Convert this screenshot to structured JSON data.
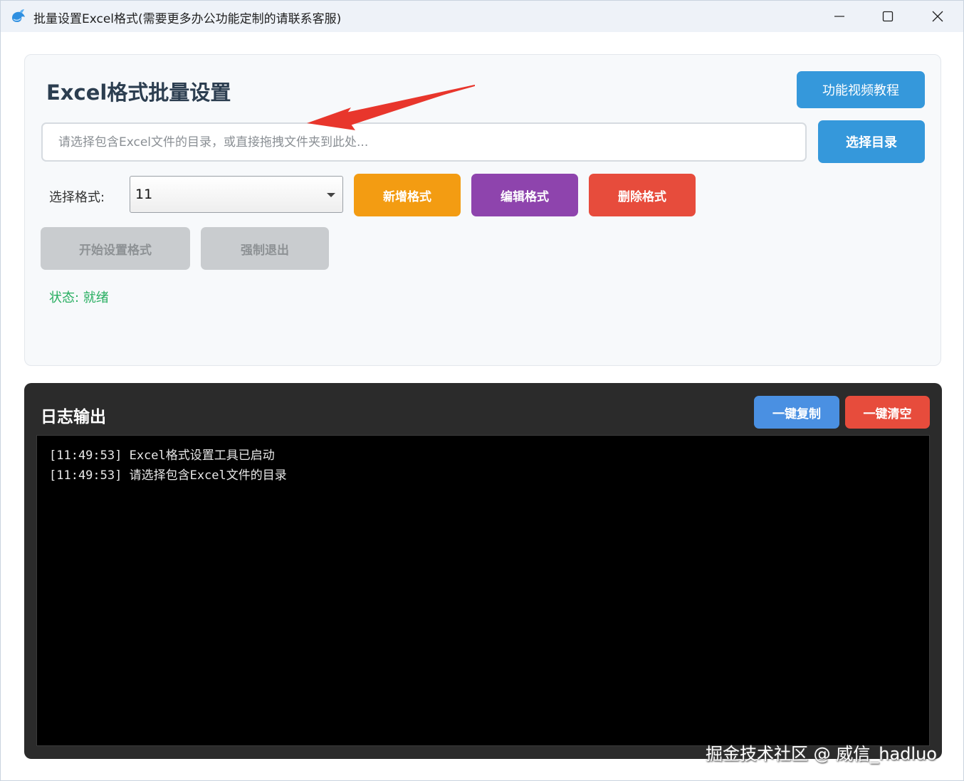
{
  "window": {
    "title": "批量设置Excel格式(需要更多办公功能定制的请联系客服)",
    "icons": {
      "app": "whale-app-icon",
      "minimize": "minimize-icon",
      "maximize": "maximize-icon",
      "close": "close-icon"
    }
  },
  "main": {
    "heading": "Excel格式批量设置",
    "video_button": "功能视频教程",
    "path_placeholder": "请选择包含Excel文件的目录，或直接拖拽文件夹到此处...",
    "path_value": "",
    "select_dir_button": "选择目录",
    "format_label": "选择格式:",
    "format_selected": "11",
    "add_format_button": "新增格式",
    "edit_format_button": "编辑格式",
    "delete_format_button": "删除格式",
    "start_button": "开始设置格式",
    "force_exit_button": "强制退出",
    "status": "状态: 就绪"
  },
  "log": {
    "heading": "日志输出",
    "copy_button": "一键复制",
    "clear_button": "一键清空",
    "lines": [
      "[11:49:53] Excel格式设置工具已启动",
      "[11:49:53] 请选择包含Excel文件的目录"
    ]
  },
  "watermark": "掘金技术社区 @ 威信_hadluo",
  "colors": {
    "primary_blue": "#3598db",
    "orange": "#f39c12",
    "purple": "#8e44ad",
    "red": "#e74c3c",
    "disabled": "#c9cccf",
    "status_green": "#27ae60",
    "annotation_red": "#e8362c"
  }
}
